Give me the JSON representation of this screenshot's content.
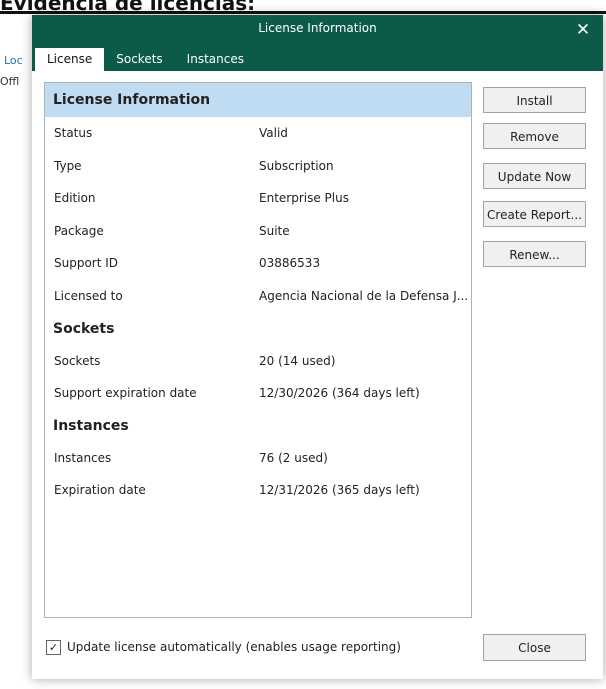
{
  "document": {
    "heading": "Evidencia de licencias:",
    "bg_link_text": "Loc",
    "bg_text": "Offl"
  },
  "dialog": {
    "title": "License Information",
    "close_glyph": "✕",
    "tabs": [
      {
        "label": "License"
      },
      {
        "label": "Sockets"
      },
      {
        "label": "Instances"
      }
    ],
    "sections": {
      "license_title": "License Information",
      "sockets_title": "Sockets",
      "instances_title": "Instances"
    },
    "license_rows": [
      {
        "key": "Status",
        "value": "Valid"
      },
      {
        "key": "Type",
        "value": "Subscription"
      },
      {
        "key": "Edition",
        "value": "Enterprise Plus"
      },
      {
        "key": "Package",
        "value": "Suite"
      },
      {
        "key": "Support ID",
        "value": "03886533"
      },
      {
        "key": "Licensed to",
        "value": "Agencia Nacional de la Defensa J..."
      }
    ],
    "sockets_rows": [
      {
        "key": "Sockets",
        "value": "20 (14 used)"
      },
      {
        "key": "Support expiration date",
        "value": "12/30/2026 (364 days left)"
      }
    ],
    "instances_rows": [
      {
        "key": "Instances",
        "value": "76 (2 used)"
      },
      {
        "key": "Expiration date",
        "value": "12/31/2026 (365 days left)"
      }
    ],
    "buttons": {
      "install": "Install",
      "remove": "Remove",
      "update_now": "Update Now",
      "create_report": "Create Report...",
      "renew": "Renew...",
      "close": "Close"
    },
    "auto_update": {
      "checked": true,
      "check_glyph": "✓",
      "label": "Update license automatically (enables usage reporting)"
    },
    "colors": {
      "titlebar": "#0c5b49",
      "section_highlight": "#bfdcf3"
    }
  }
}
